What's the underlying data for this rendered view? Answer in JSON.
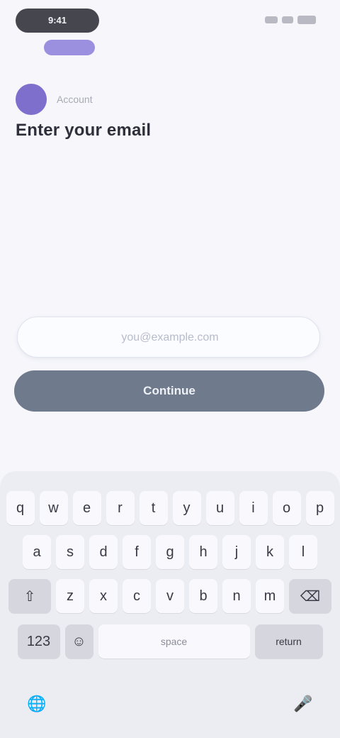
{
  "status_bar": {
    "pill_label": "9:41"
  },
  "profile": {
    "name": "Account"
  },
  "page": {
    "title": "Enter your email"
  },
  "form": {
    "input_placeholder": "you@example.com",
    "button_label": "Continue"
  },
  "keyboard": {
    "row1": [
      "q",
      "w",
      "e",
      "r",
      "t",
      "y",
      "u",
      "i",
      "o",
      "p"
    ],
    "row2": [
      "a",
      "s",
      "d",
      "f",
      "g",
      "h",
      "j",
      "k",
      "l"
    ],
    "row3": [
      "z",
      "x",
      "c",
      "v",
      "b",
      "n",
      "m"
    ],
    "shift_icon": "shift-icon",
    "delete_icon": "delete-icon",
    "mode_key": "123",
    "emoji_icon": "emoji-icon",
    "space_label": "space",
    "return_label": "return",
    "globe_icon": "globe-icon",
    "mic_icon": "microphone-icon"
  }
}
